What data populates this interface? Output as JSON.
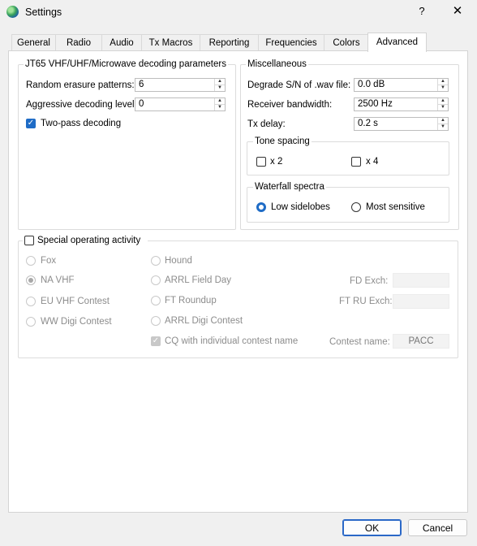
{
  "window": {
    "title": "Settings",
    "help": "?",
    "close": "✕"
  },
  "tabs": [
    "General",
    "Radio",
    "Audio",
    "Tx Macros",
    "Reporting",
    "Frequencies",
    "Colors",
    "Advanced"
  ],
  "active_tab": "Advanced",
  "jt65": {
    "title": "JT65 VHF/UHF/Microwave decoding parameters",
    "random_erasure_label": "Random erasure patterns:",
    "random_erasure_value": "6",
    "aggressive_label": "Aggressive decoding level:",
    "aggressive_value": "0",
    "two_pass_label": "Two-pass decoding",
    "two_pass_checked": true
  },
  "misc": {
    "title": "Miscellaneous",
    "degrade_label": "Degrade S/N of .wav file:",
    "degrade_value": "0.0 dB",
    "rx_bw_label": "Receiver bandwidth:",
    "rx_bw_value": "2500  Hz",
    "tx_delay_label": "Tx delay:",
    "tx_delay_value": "0.2  s",
    "tone_spacing_title": "Tone spacing",
    "x2_label": "x 2",
    "x4_label": "x 4",
    "waterfall_title": "Waterfall spectra",
    "low_sidelobes_label": "Low sidelobes",
    "most_sensitive_label": "Most sensitive",
    "waterfall_selected": "Low sidelobes"
  },
  "special": {
    "title": "Special operating activity",
    "enabled": false,
    "fox": "Fox",
    "hound": "Hound",
    "na_vhf": "NA VHF",
    "arrl_field_day": "ARRL Field Day",
    "eu_vhf": "EU VHF Contest",
    "ft_roundup": "FT Roundup",
    "ww_digi": "WW Digi Contest",
    "arrl_digi": "ARRL Digi Contest",
    "cq_individual": "CQ with individual contest name",
    "fd_exch_label": "FD Exch:",
    "fd_exch_value": "",
    "ft_ru_exch_label": "FT RU Exch:",
    "ft_ru_exch_value": "",
    "contest_name_label": "Contest name:",
    "contest_name_value": "PACC",
    "selected": "NA VHF"
  },
  "buttons": {
    "ok": "OK",
    "cancel": "Cancel"
  }
}
